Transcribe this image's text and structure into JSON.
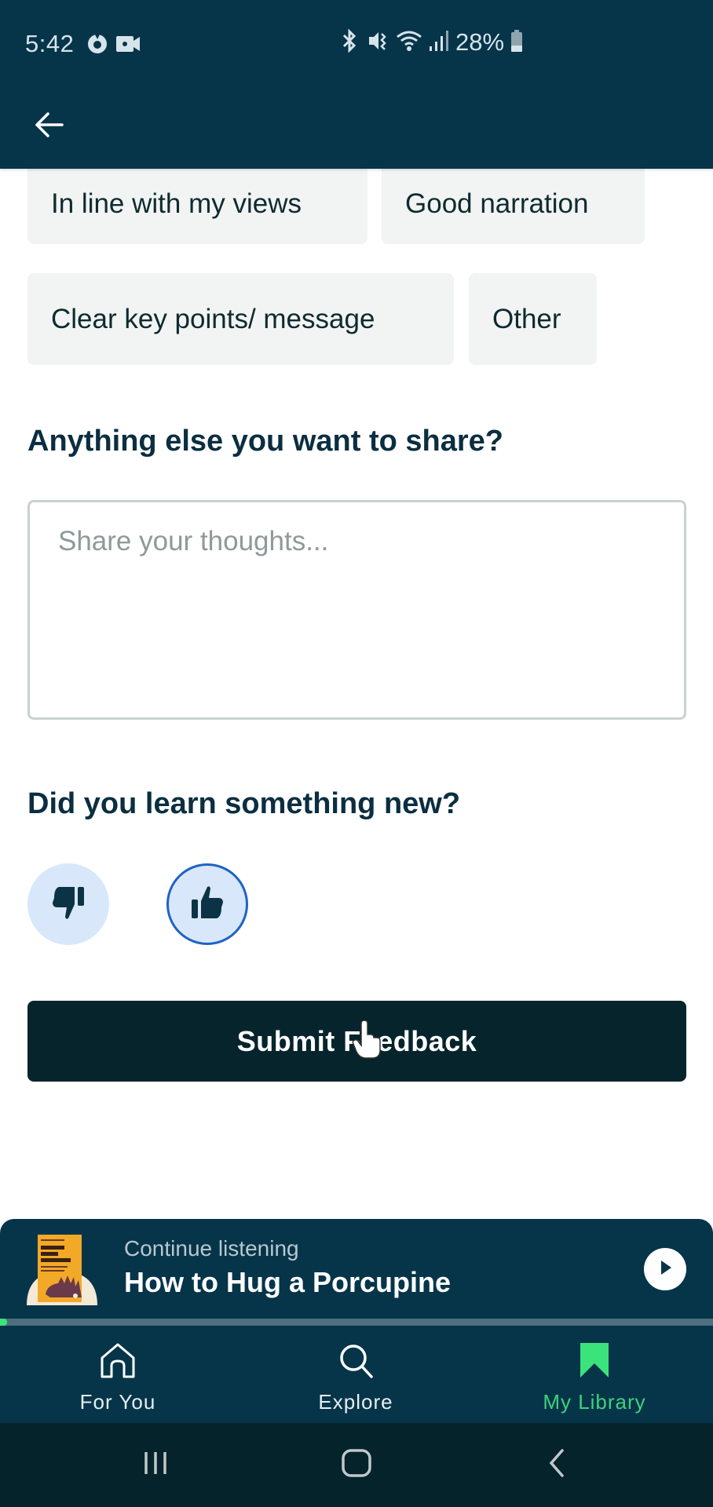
{
  "status_bar": {
    "time": "5:42",
    "battery": "28%",
    "left_icons": [
      "focus-mode-icon",
      "video-recording-icon"
    ],
    "right_icons": [
      "bluetooth-icon",
      "vibrate-mute-icon",
      "wifi-icon",
      "signal-icon",
      "battery-icon"
    ]
  },
  "header": {
    "back_icon": "arrow-left-icon"
  },
  "feedback": {
    "reason_chips": [
      {
        "label": "In line with my views"
      },
      {
        "label": "Good narration"
      },
      {
        "label": "Clear key points/ message"
      },
      {
        "label": "Other"
      }
    ],
    "share_title": "Anything else you want to share?",
    "share_placeholder": "Share your thoughts...",
    "share_value": "",
    "learn_title": "Did you learn something new?",
    "learn_options": [
      {
        "icon": "thumbs-down-icon",
        "selected": false
      },
      {
        "icon": "thumbs-up-icon",
        "selected": true
      }
    ],
    "submit_label": "Submit Feedback"
  },
  "mini_player": {
    "label": "Continue listening",
    "title": "How to Hug a Porcupine",
    "play_icon": "play-icon",
    "progress": 0.01
  },
  "bottom_nav": {
    "items": [
      {
        "label": "For You",
        "icon": "home-icon",
        "active": false
      },
      {
        "label": "Explore",
        "icon": "search-icon",
        "active": false
      },
      {
        "label": "My Library",
        "icon": "bookmark-icon",
        "active": true
      }
    ]
  },
  "system_nav": {
    "buttons": [
      "recent-apps-icon",
      "home-button-icon",
      "back-chevron-icon"
    ]
  },
  "colors": {
    "header_bg": "#06354a",
    "chip_bg": "#f1f4f2",
    "submit_bg": "#06242c",
    "accent_green": "#3fd27a",
    "selected_ring": "#1f63c4",
    "vote_bg": "#d8e8fa"
  }
}
